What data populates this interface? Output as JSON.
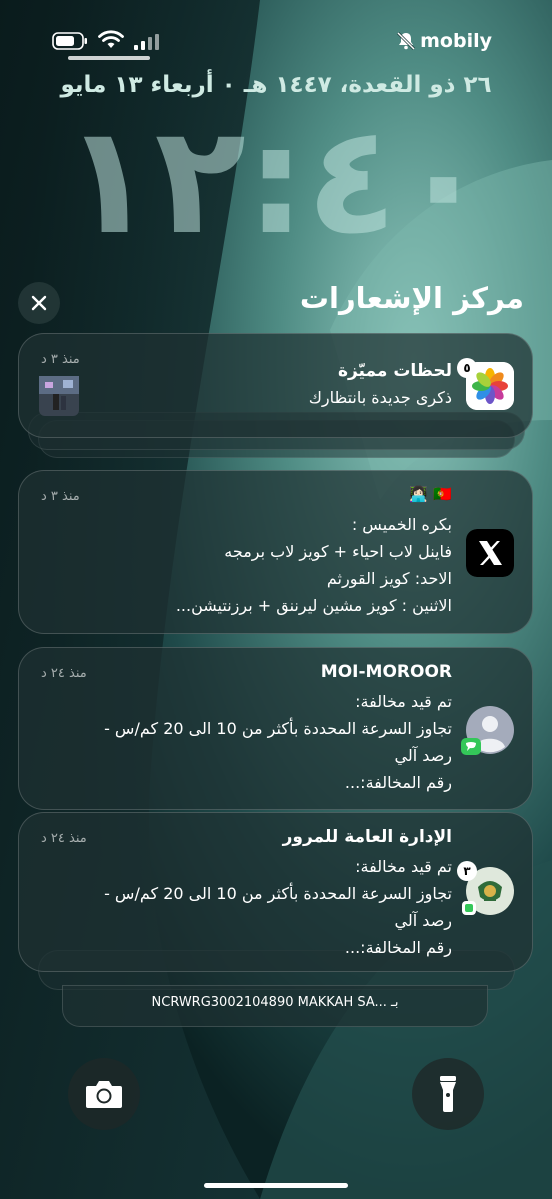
{
  "status": {
    "carrier": "mobily",
    "icons": [
      "battery-icon",
      "wifi-icon",
      "signal-icon",
      "silent-bell-icon"
    ]
  },
  "lock": {
    "date": "٢٦ ذو القعدة، ١٤٤٧ هـ ٠ أربعاء ١٣ مايو",
    "time": "١٢:٤٠"
  },
  "notification_center": {
    "title": "مركز الإشعارات",
    "close_icon": "close-icon"
  },
  "notifications": [
    {
      "app": "Photos",
      "icon": "photos-icon",
      "badge": "٥",
      "title": "لحظات مميّزة",
      "body": "ذكرى جديدة بانتظارك",
      "time": "منذ ٣ د"
    },
    {
      "app": "X",
      "icon": "x-icon",
      "title": "🇵🇹 👩🏻‍💻",
      "body": "بكره الخميس :\nفاينل لاب احياء + كويز لاب برمجه\nالاحد: كويز القورثم\nالاثنين : كويز مشين ليرننق + برزنتيشن...",
      "time": "منذ ٣ د"
    },
    {
      "app": "Messages",
      "icon": "contact-avatar-icon",
      "title": "MOI-MOROOR",
      "body": "تم قيد مخالفة:\nتجاوز السرعة المحددة بأكثر من 10 الى 20 كم/س  -\nرصد آلي\nرقم المخالفة:...",
      "time": "منذ ٢٤ د"
    },
    {
      "app": "Traffic",
      "icon": "traffic-emblem-icon",
      "badge": "٣",
      "title": "الإدارة العامة للمرور",
      "body": "تم قيد مخالفة:\nتجاوز السرعة المحددة بأكثر من 10 الى 20 كم/س  -\nرصد آلي\nرقم المخالفة:...",
      "time": "منذ ٢٤ د"
    }
  ],
  "stack_peek": "NCRWRG3002104890 MAKKAH SA... بـ",
  "quick_actions": {
    "camera": "camera-icon",
    "flashlight": "flashlight-icon"
  },
  "colors": {
    "wallpaper_dark": "#0e2a2b",
    "wallpaper_light": "#5f9e94",
    "card_bg": "#1e3032"
  }
}
